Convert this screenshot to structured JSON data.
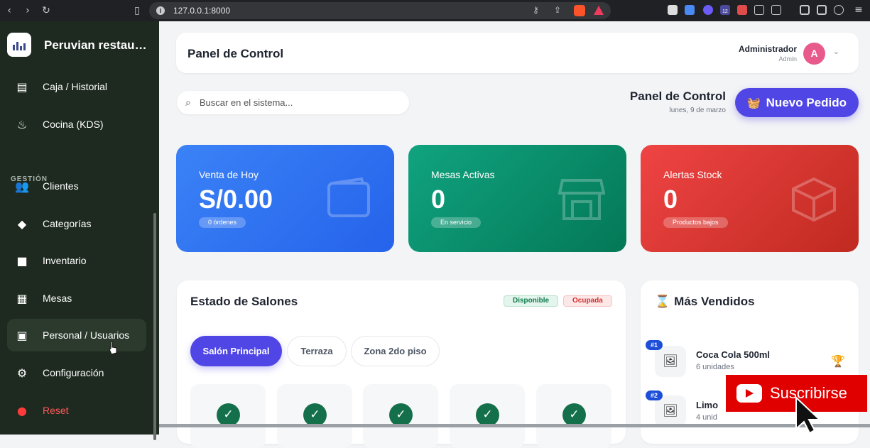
{
  "browser": {
    "url": "127.0.0.1:8000",
    "ext_badge": "12"
  },
  "sidebar": {
    "brand": "Peruvian restaurant",
    "section_label": "GESTIÓN",
    "items": [
      {
        "label": "Caja / Historial",
        "icon": "cash-register-icon"
      },
      {
        "label": "Cocina (KDS)",
        "icon": "fire-icon"
      },
      {
        "label": "Clientes",
        "icon": "users-icon"
      },
      {
        "label": "Categorías",
        "icon": "tag-icon"
      },
      {
        "label": "Inventario",
        "icon": "box-icon"
      },
      {
        "label": "Mesas",
        "icon": "grid-icon"
      },
      {
        "label": "Personal / Usuarios",
        "icon": "id-badge-icon"
      },
      {
        "label": "Configuración",
        "icon": "gear-icon"
      },
      {
        "label": "Reset",
        "icon": "alert-icon"
      }
    ]
  },
  "header": {
    "title": "Panel de Control",
    "user_name": "Administrador",
    "user_role": "Admin",
    "avatar_letter": "A"
  },
  "search": {
    "placeholder": "Buscar en el sistema..."
  },
  "page": {
    "title": "Panel de Control",
    "date": "lunes, 9 de marzo",
    "new_order_label": "Nuevo Pedido"
  },
  "stats": [
    {
      "label": "Venta de Hoy",
      "value": "S/0.00",
      "pill": "0 órdenes",
      "color": "#2563eb"
    },
    {
      "label": "Mesas Activas",
      "value": "0",
      "pill": "En servicio",
      "color": "#059669"
    },
    {
      "label": "Alertas Stock",
      "value": "0",
      "pill": "Productos bajos",
      "color": "#dc2626"
    }
  ],
  "salones": {
    "title": "Estado de Salones",
    "legend_available": "Disponible",
    "legend_occupied": "Ocupada",
    "tabs": [
      "Salón Principal",
      "Terraza",
      "Zona 2do piso"
    ]
  },
  "top_sellers": {
    "title": "Más Vendidos",
    "items": [
      {
        "rank": "#1",
        "name": "Coca Cola 500ml",
        "qty": "6 unidades"
      },
      {
        "rank": "#2",
        "name": "Limo",
        "qty": "4 unid"
      }
    ]
  },
  "overlay": {
    "subscribe_label": "Suscribirse"
  }
}
